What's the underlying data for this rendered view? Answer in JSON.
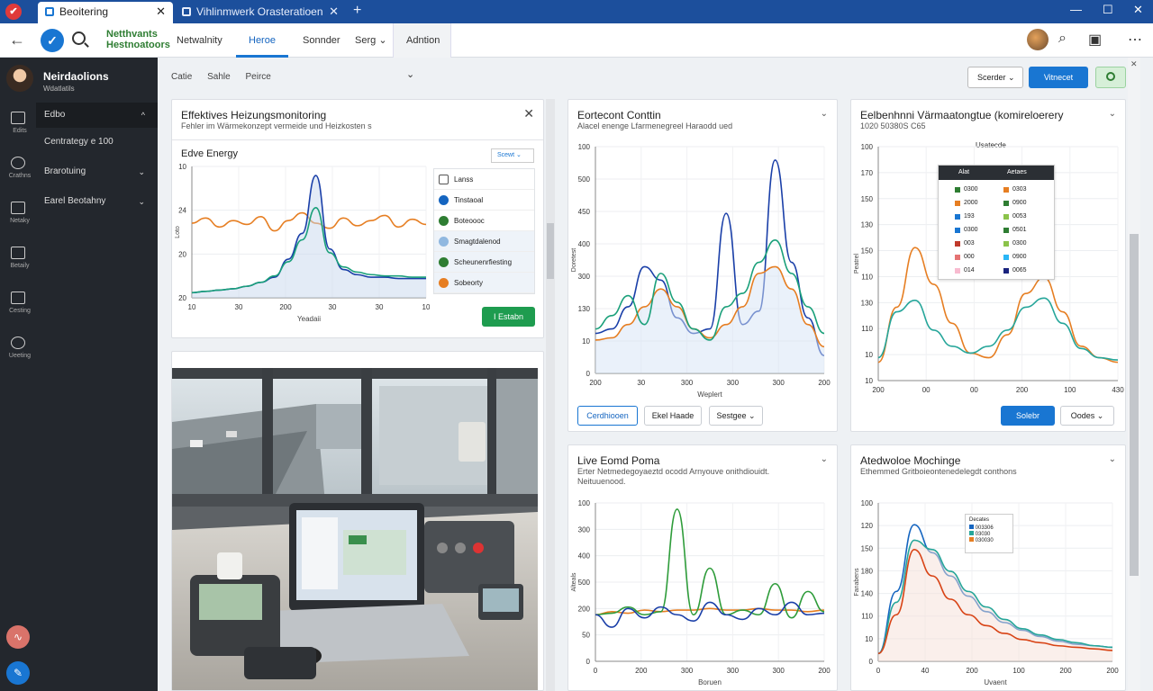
{
  "browser": {
    "tabs": [
      {
        "label": "Beoitering",
        "active": true
      },
      {
        "label": "Vihlinmwerk Orasteratioen",
        "active": false
      }
    ]
  },
  "nav": {
    "brand_line1": "Netthvants",
    "brand_line2": "Hestnoatoors",
    "items": [
      "Netwalnity",
      "Heroe",
      "Sonnder",
      "Serg",
      "Adntion"
    ],
    "active_index": 1
  },
  "sidebar": {
    "user_name": "Neirdaolions",
    "user_sub": "Wdatlatils",
    "rail": [
      "Edits",
      "Crathns",
      "Netaky",
      "Betaily",
      "Cesting",
      "Ueeting"
    ],
    "menu": [
      {
        "label": "Edbo",
        "chev": "^",
        "active": true
      },
      {
        "label": "Centrategy e 100",
        "chev": "",
        "active": false
      },
      {
        "label": "Brarotuing",
        "chev": "v",
        "active": false
      },
      {
        "label": "Earel Beotahny",
        "chev": "v",
        "active": false
      }
    ]
  },
  "toolbar": {
    "crumbs": [
      "Catie",
      "Sahle",
      "Peirce"
    ],
    "select_label": "Scerder",
    "primary_label": "Vitnecet"
  },
  "card1": {
    "title": "Effektives Heizungsmonitoring",
    "subtitle": "Fehler im Wärmekonzept vermeide und Heizkosten s",
    "chart_title": "Edve Energy",
    "sort_label": "Scewt",
    "list": [
      "Lanss",
      "Tinstaoal",
      "Boteoooc",
      "Smagtdalenod",
      "Scheunenrfiesting",
      "Sobeorty"
    ],
    "list_colors": [
      "#ffffff",
      "#1565c0",
      "#2e7d32",
      "#90b8e0",
      "#2e7d32",
      "#e67e22"
    ],
    "button_label": "I Estabn",
    "xlabel": "Yeadaii"
  },
  "card2": {
    "title": "Eortecont Conttin",
    "subtitle": "Alacel enenge Lfarmenegreel Haraodd ued",
    "xlabel": "Weplert",
    "btn1": "Cerdhiooen",
    "btn2": "Ekel Haade",
    "btn3": "Sestgee"
  },
  "card3": {
    "title": "Eelbenhnni Värmaatongtue (komireloerery",
    "subtitle": "1020 50380S C65",
    "legend_title": "Usatecde",
    "legend_head": [
      "Alat",
      "Aetaes"
    ],
    "legend_rows": [
      [
        "0300",
        "0303"
      ],
      [
        "2000",
        "0900"
      ],
      [
        "193",
        "0053"
      ],
      [
        "0300",
        "0501"
      ],
      [
        "003",
        "0300"
      ],
      [
        "000",
        "0900"
      ],
      [
        "014",
        "0065"
      ]
    ],
    "legend_colors_a": [
      "#2e7d32",
      "#e67e22",
      "#1976d2",
      "#1976d2",
      "#c0392b",
      "#e57373",
      "#f8bbd0"
    ],
    "legend_colors_b": [
      "#e67e22",
      "#2e7d32",
      "#8bc34a",
      "#2e7d32",
      "#8bc34a",
      "#29b6f6",
      "#1a237e"
    ],
    "btn1": "Solebr",
    "btn2": "Oodes"
  },
  "card4": {
    "title": "Live Eomd Poma",
    "subtitle": "Erter Netmedegoyaeztd ocodd Arnyouve onithdiouidt. Neituuenood.",
    "xlabel": "Boruen"
  },
  "card5": {
    "title": "Atedwoloe Mochinge",
    "subtitle": "Ethemmed Gritboieontenedelegdt conthons",
    "legend_title": "Decates",
    "legend_items": [
      "003306",
      "03030",
      "030030"
    ],
    "legend_colors": [
      "#1565c0",
      "#26a69a",
      "#e67e22"
    ],
    "xlabel": "Uvaent"
  },
  "chart_data": [
    {
      "type": "line",
      "title": "Edve Energy",
      "xlabel": "Yeadaii",
      "ylabel": "Loto",
      "x_ticks": [
        "10",
        "30",
        "200",
        "30",
        "30",
        "10"
      ],
      "y_ticks": [
        "10",
        "24",
        "20",
        "20"
      ],
      "series": [
        {
          "color": "#e67e22",
          "values": [
            0.58,
            0.62,
            0.55,
            0.6,
            0.57,
            0.63,
            0.52,
            0.6,
            0.66,
            0.58,
            0.54,
            0.62,
            0.56,
            0.6,
            0.64,
            0.55,
            0.61,
            0.57
          ]
        },
        {
          "color": "#1a3fa8",
          "values": [
            0.04,
            0.05,
            0.06,
            0.07,
            0.09,
            0.12,
            0.16,
            0.3,
            0.5,
            0.95,
            0.38,
            0.22,
            0.18,
            0.16,
            0.16,
            0.15,
            0.15,
            0.15
          ]
        },
        {
          "color": "#1aa07a",
          "values": [
            0.04,
            0.05,
            0.06,
            0.07,
            0.09,
            0.12,
            0.17,
            0.28,
            0.45,
            0.7,
            0.35,
            0.24,
            0.2,
            0.18,
            0.17,
            0.17,
            0.16,
            0.16
          ]
        }
      ]
    },
    {
      "type": "line",
      "xlabel": "Weplert",
      "ylabel": "Doretest",
      "x_ticks": [
        "200",
        "30",
        "300",
        "300",
        "300",
        "200"
      ],
      "y_ticks": [
        "100",
        "500",
        "450",
        "400",
        "300",
        "130",
        "10",
        "0"
      ],
      "series": [
        {
          "color": "#1a3fa8",
          "values": [
            0.18,
            0.2,
            0.3,
            0.48,
            0.42,
            0.25,
            0.18,
            0.2,
            0.72,
            0.22,
            0.28,
            0.96,
            0.5,
            0.25,
            0.08
          ]
        },
        {
          "color": "#e67e22",
          "values": [
            0.15,
            0.16,
            0.22,
            0.3,
            0.38,
            0.3,
            0.2,
            0.16,
            0.22,
            0.3,
            0.45,
            0.48,
            0.38,
            0.22,
            0.12
          ]
        },
        {
          "color": "#1aa07a",
          "values": [
            0.2,
            0.26,
            0.35,
            0.22,
            0.45,
            0.32,
            0.2,
            0.15,
            0.3,
            0.36,
            0.5,
            0.6,
            0.45,
            0.3,
            0.18
          ]
        }
      ]
    },
    {
      "type": "line",
      "xlabel": "",
      "ylabel": "Peatrel",
      "x_ticks": [
        "200",
        "00",
        "00",
        "200",
        "100",
        "430"
      ],
      "y_ticks": [
        "100",
        "170",
        "150",
        "130",
        "150",
        "110",
        "130",
        "110",
        "10",
        "10"
      ],
      "series": [
        {
          "color": "#e67e22",
          "values": [
            0.08,
            0.32,
            0.58,
            0.42,
            0.25,
            0.12,
            0.1,
            0.2,
            0.38,
            0.45,
            0.3,
            0.15,
            0.1,
            0.08
          ]
        },
        {
          "color": "#26a69a",
          "values": [
            0.1,
            0.3,
            0.35,
            0.22,
            0.15,
            0.12,
            0.15,
            0.22,
            0.32,
            0.36,
            0.25,
            0.14,
            0.1,
            0.09
          ]
        }
      ]
    },
    {
      "type": "line",
      "xlabel": "Boruen",
      "ylabel": "Alteals",
      "x_ticks": [
        "0",
        "200",
        "300",
        "300",
        "300",
        "200"
      ],
      "y_ticks": [
        "100",
        "300",
        "400",
        "500",
        "200",
        "50",
        "0"
      ],
      "series": [
        {
          "color": "#e67e22",
          "values": [
            0.3,
            0.32,
            0.31,
            0.33,
            0.32,
            0.33,
            0.33,
            0.34,
            0.33,
            0.33,
            0.34,
            0.33,
            0.33,
            0.32,
            0.33
          ]
        },
        {
          "color": "#2e9c3a",
          "values": [
            0.3,
            0.31,
            0.35,
            0.3,
            0.32,
            0.98,
            0.3,
            0.6,
            0.3,
            0.33,
            0.3,
            0.5,
            0.28,
            0.45,
            0.32
          ]
        },
        {
          "color": "#1a3fa8",
          "values": [
            0.3,
            0.22,
            0.34,
            0.28,
            0.35,
            0.3,
            0.26,
            0.38,
            0.3,
            0.27,
            0.34,
            0.3,
            0.38,
            0.3,
            0.31
          ]
        }
      ]
    },
    {
      "type": "line",
      "xlabel": "Uvaent",
      "ylabel": "Fanabens",
      "x_ticks": [
        "0",
        "40",
        "200",
        "100",
        "200",
        "200"
      ],
      "y_ticks": [
        "100",
        "120",
        "150",
        "180",
        "140",
        "110",
        "10",
        "0"
      ],
      "series": [
        {
          "color": "#1565c0",
          "values": [
            0.05,
            0.45,
            0.88,
            0.7,
            0.55,
            0.42,
            0.32,
            0.25,
            0.2,
            0.16,
            0.13,
            0.11,
            0.1,
            0.09
          ]
        },
        {
          "color": "#26a69a",
          "values": [
            0.05,
            0.38,
            0.78,
            0.72,
            0.58,
            0.45,
            0.35,
            0.27,
            0.21,
            0.17,
            0.14,
            0.12,
            0.1,
            0.09
          ]
        },
        {
          "color": "#d84315",
          "values": [
            0.05,
            0.3,
            0.72,
            0.55,
            0.4,
            0.3,
            0.23,
            0.18,
            0.14,
            0.12,
            0.1,
            0.09,
            0.08,
            0.07
          ]
        }
      ]
    }
  ]
}
